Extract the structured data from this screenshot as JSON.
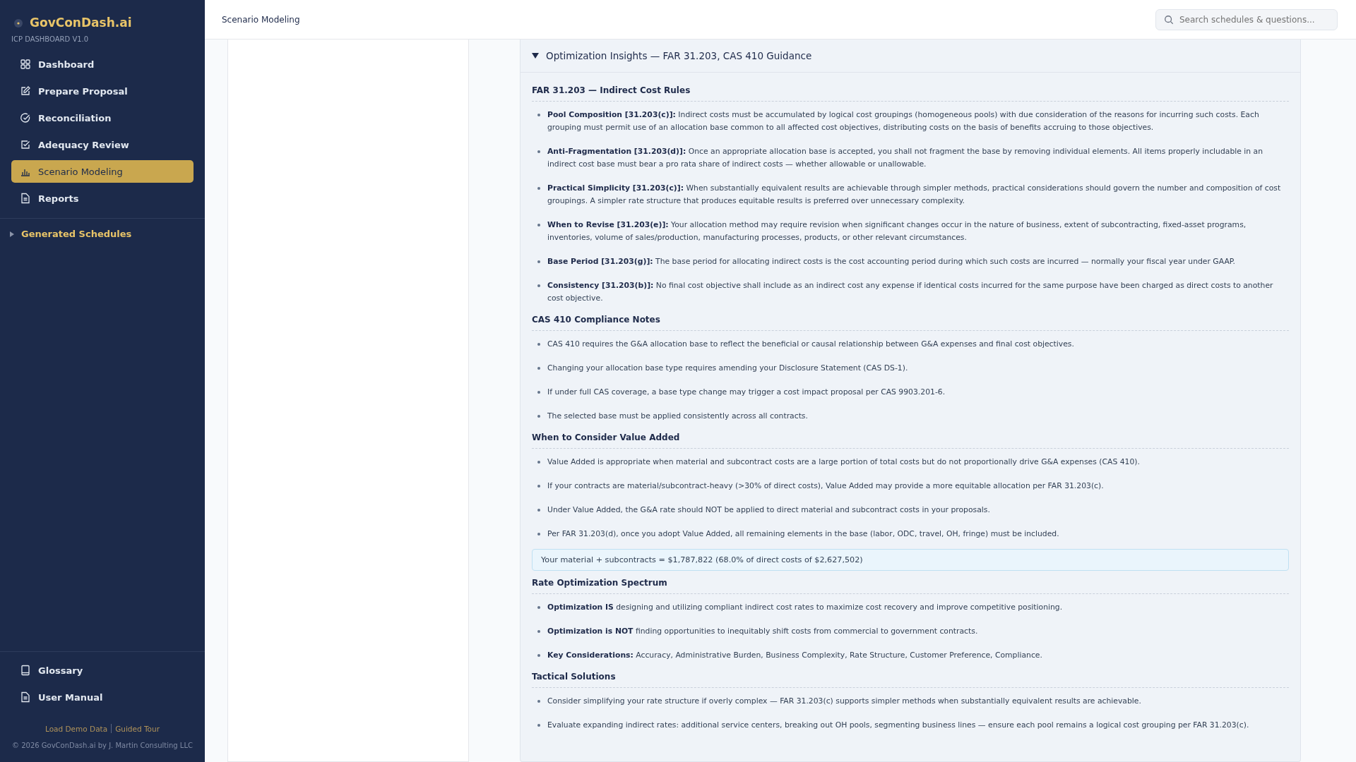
{
  "sidebar": {
    "brand": "GovConDash.ai",
    "subtitle": "ICP DASHBOARD V1.0",
    "items": [
      {
        "label": "Dashboard",
        "kind": "grid",
        "selected": false
      },
      {
        "label": "Prepare Proposal",
        "kind": "edit",
        "selected": false
      },
      {
        "label": "Reconciliation",
        "kind": "verify",
        "selected": false
      },
      {
        "label": "Adequacy Review",
        "kind": "review",
        "selected": false
      },
      {
        "label": "Scenario Modeling",
        "kind": "chart",
        "selected": true
      },
      {
        "label": "Reports",
        "kind": "document",
        "selected": false
      }
    ],
    "group": {
      "label": "Generated Schedules",
      "expanded": false
    },
    "footer_items": [
      {
        "label": "Glossary",
        "kind": "book"
      },
      {
        "label": "User Manual",
        "kind": "document"
      }
    ],
    "links": [
      "Load Demo Data",
      "Guided Tour"
    ],
    "copyright": "© 2026 GovConDash.ai by J. Martin Consulting LLC"
  },
  "header": {
    "title": "Scenario Modeling",
    "search": {
      "placeholder": "Search schedules & questions..."
    }
  },
  "insights": {
    "title": "Optimization Insights — FAR 31.203, CAS 410 Guidance",
    "expanded": true,
    "sections": [
      {
        "heading": "FAR 31.203 — Indirect Cost Rules",
        "items": [
          "**Pool Composition [31.203(c)]:** Indirect costs must be accumulated by logical cost groupings (homogeneous pools) with due consideration of the reasons for incurring such costs. Each grouping must permit use of an allocation base common to all affected cost objectives, distributing costs on the basis of benefits accruing to those objectives.",
          "**Anti-Fragmentation [31.203(d)]:** Once an appropriate allocation base is accepted, you shall not fragment the base by removing individual elements. All items properly includable in an indirect cost base must bear a pro rata share of indirect costs — whether allowable or unallowable.",
          "**Practical Simplicity [31.203(c)]:** When substantially equivalent results are achievable through simpler methods, practical considerations should govern the number and composition of cost groupings. A simpler rate structure that produces equitable results is preferred over unnecessary complexity.",
          "**When to Revise [31.203(e)]:** Your allocation method may require revision when significant changes occur in the nature of business, extent of subcontracting, fixed-asset programs, inventories, volume of sales/production, manufacturing processes, products, or other relevant circumstances.",
          "**Base Period [31.203(g)]:** The base period for allocating indirect costs is the cost accounting period during which such costs are incurred — normally your fiscal year under GAAP.",
          "**Consistency [31.203(b)]:** No final cost objective shall include as an indirect cost any expense if identical costs incurred for the same purpose have been charged as direct costs to another cost objective."
        ]
      },
      {
        "heading": "CAS 410 Compliance Notes",
        "items": [
          "CAS 410 requires the G&A allocation base to reflect the beneficial or causal relationship between G&A expenses and final cost objectives.",
          "Changing your allocation base type requires amending your Disclosure Statement (CAS DS-1).",
          "If under full CAS coverage, a base type change may trigger a cost impact proposal per CAS 9903.201-6.",
          "The selected base must be applied consistently across all contracts."
        ]
      },
      {
        "heading": "When to Consider Value Added",
        "items": [
          "Value Added is appropriate when material and subcontract costs are a large portion of total costs but do not proportionally drive G&A expenses (CAS 410).",
          "If your contracts are material/subcontract-heavy (>30% of direct costs), Value Added may provide a more equitable allocation per FAR 31.203(c).",
          "Under Value Added, the G&A rate should NOT be applied to direct material and subcontract costs in your proposals.",
          "Per FAR 31.203(d), once you adopt Value Added, all remaining elements in the base (labor, ODC, travel, OH, fringe) must be included."
        ],
        "note": "Your material + subcontracts = $1,787,822 (68.0% of direct costs of $2,627,502)"
      },
      {
        "heading": "Rate Optimization Spectrum",
        "items": [
          "**Optimization IS** designing and utilizing compliant indirect cost rates to maximize cost recovery and improve competitive positioning.",
          "**Optimization is NOT** finding opportunities to inequitably shift costs from commercial to government contracts.",
          "**Key Considerations:** Accuracy, Administrative Burden, Business Complexity, Rate Structure, Customer Preference, Compliance."
        ]
      },
      {
        "heading": "Tactical Solutions",
        "items": [
          "Consider simplifying your rate structure if overly complex — FAR 31.203(c) supports simpler methods when substantially equivalent results are achievable.",
          "Evaluate expanding indirect rates: additional service centers, breaking out OH pools, segmenting business lines — ensure each pool remains a logical cost grouping per FAR 31.203(c)."
        ]
      }
    ]
  }
}
